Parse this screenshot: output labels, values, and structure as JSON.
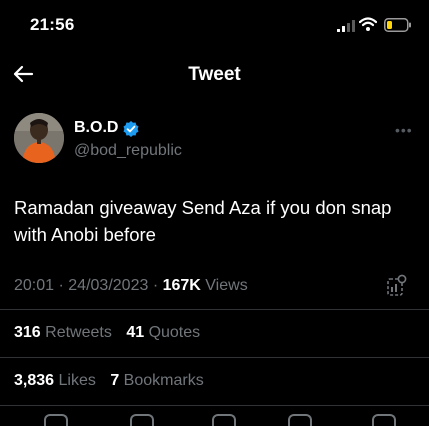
{
  "status_bar": {
    "time": "21:56"
  },
  "nav": {
    "title": "Tweet"
  },
  "author": {
    "name": "B.O.D",
    "handle": "@bod_republic",
    "verified": true
  },
  "tweet": {
    "text": "Ramadan giveaway Send Aza if you don snap with Anobi before",
    "time": "20:01",
    "date": "24/03/2023",
    "views_count": "167K",
    "views_label": "Views"
  },
  "stats": {
    "retweets_count": "316",
    "retweets_label": "Retweets",
    "quotes_count": "41",
    "quotes_label": "Quotes",
    "likes_count": "3,836",
    "likes_label": "Likes",
    "bookmarks_count": "7",
    "bookmarks_label": "Bookmarks"
  },
  "colors": {
    "background": "#000000",
    "text": "#e7e9ea",
    "muted": "#71767b",
    "verified": "#1d9bf0",
    "divider": "#2f3336"
  },
  "icons": [
    "back-arrow-icon",
    "verified-badge-icon",
    "more-options-icon",
    "analytics-icon",
    "signal-icon",
    "wifi-icon",
    "battery-icon"
  ]
}
